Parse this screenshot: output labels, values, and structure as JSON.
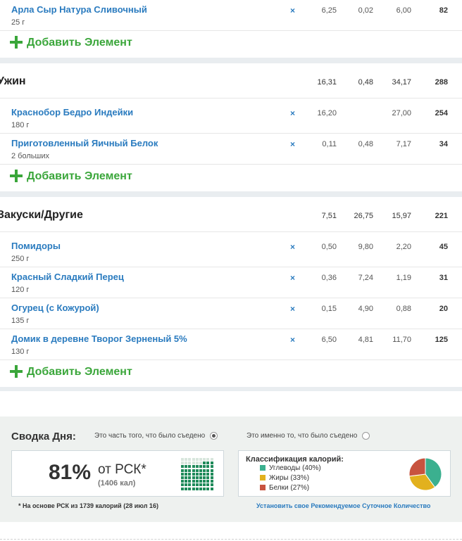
{
  "lunch_tail": {
    "items": [
      {
        "name": "Арла Сыр Натура Сливочный",
        "qty": "25 г",
        "carbs": "6,25",
        "fat": "0,02",
        "protein": "6,00",
        "kcal": "82"
      }
    ],
    "add_label": "Добавить Элемент"
  },
  "dinner": {
    "title": "Ужин",
    "totals": {
      "carbs": "16,31",
      "fat": "0,48",
      "protein": "34,17",
      "kcal": "288"
    },
    "items": [
      {
        "name": "Краснобор Бедро Индейки",
        "qty": "180 г",
        "carbs": "16,20",
        "fat": "",
        "protein": "27,00",
        "kcal": "254"
      },
      {
        "name": "Приготовленный Яичный Белок",
        "qty": "2 больших",
        "carbs": "0,11",
        "fat": "0,48",
        "protein": "7,17",
        "kcal": "34"
      }
    ],
    "add_label": "Добавить Элемент"
  },
  "snacks": {
    "title": "Закуски/Другие",
    "totals": {
      "carbs": "7,51",
      "fat": "26,75",
      "protein": "15,97",
      "kcal": "221"
    },
    "items": [
      {
        "name": "Помидоры",
        "qty": "250 г",
        "carbs": "0,50",
        "fat": "9,80",
        "protein": "2,20",
        "kcal": "45"
      },
      {
        "name": "Красный Сладкий Перец",
        "qty": "120 г",
        "carbs": "0,36",
        "fat": "7,24",
        "protein": "1,19",
        "kcal": "31"
      },
      {
        "name": "Огурец (с Кожурой)",
        "qty": "135 г",
        "carbs": "0,15",
        "fat": "4,90",
        "protein": "0,88",
        "kcal": "20"
      },
      {
        "name": "Домик в деревне Творог Зерненый 5%",
        "qty": "130 г",
        "carbs": "6,50",
        "fat": "4,81",
        "protein": "11,70",
        "kcal": "125"
      }
    ],
    "add_label": "Добавить Элемент"
  },
  "delete_glyph": "×",
  "summary": {
    "title": "Сводка Дня:",
    "option_eaten_part": "Это часть того, что было съедено",
    "option_exactly": "Это именно то, что было съедено",
    "selected_option": "option_eaten_part",
    "percent": "81%",
    "of_rsk": "от РСК*",
    "kcal_paren": "(1406 кал)",
    "progress_fraction": 0.81,
    "classification": {
      "title": "Классификация калорий:",
      "items": [
        {
          "label": "Углеводы (40%)",
          "value": 40,
          "color": "#3bb08f"
        },
        {
          "label": "Жиры (33%)",
          "value": 33,
          "color": "#e2b11e"
        },
        {
          "label": "Белки (27%)",
          "value": 27,
          "color": "#c8533f"
        }
      ]
    },
    "footnote": "* На основе РСК из 1739 калорий (28 июл 16)",
    "set_link": "Установить свое Рекомендуемое Суточное Количество"
  }
}
